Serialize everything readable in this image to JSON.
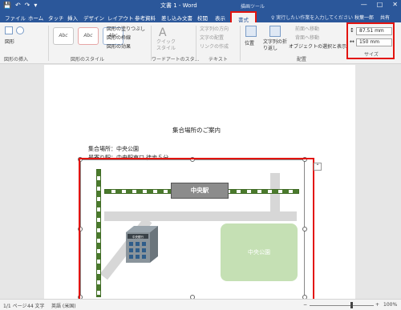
{
  "titlebar": {
    "document_title": "文書 1 - Word",
    "context_title": "描画ツール",
    "qat": [
      "save-icon",
      "undo-icon",
      "redo-icon",
      "dropdown-icon"
    ],
    "window_buttons": [
      "—",
      "□",
      "✕"
    ]
  },
  "tabs": [
    {
      "id": "file",
      "label": "ファイル"
    },
    {
      "id": "home",
      "label": "ホーム"
    },
    {
      "id": "touch",
      "label": "タッチ"
    },
    {
      "id": "insert",
      "label": "挿入"
    },
    {
      "id": "design",
      "label": "デザイン"
    },
    {
      "id": "layout",
      "label": "レイアウト"
    },
    {
      "id": "references",
      "label": "参考資料"
    },
    {
      "id": "mailings",
      "label": "差し込み文書"
    },
    {
      "id": "review",
      "label": "校閲"
    },
    {
      "id": "view",
      "label": "表示"
    },
    {
      "id": "format",
      "label": "書式",
      "active": true
    }
  ],
  "tellme": "♀ 実行したい作業を入力してください",
  "user": "秋葉一郎",
  "share": "共有",
  "ribbon": {
    "insert_shapes": {
      "label": "図形の挿入",
      "shapes_button": "図形"
    },
    "shape_styles": {
      "label": "図形のスタイル",
      "swatches": [
        "Abc",
        "Abc",
        "Abc"
      ],
      "fill": "図形の塗りつぶし",
      "outline": "図形の枠線",
      "effects": "図形の効果"
    },
    "wordart": {
      "label": "ワードアートのスタ…",
      "quick_style": "クイック\nスタイル"
    },
    "text": {
      "label": "テキスト",
      "direction": "文字列の方向",
      "align": "文字の配置",
      "link": "リンクの作成"
    },
    "arrange": {
      "label": "配置",
      "position": "位置",
      "wrap": "文字列の折\nり返し",
      "forward": "前面へ移動",
      "backward": "背面へ移動",
      "selection_pane": "オブジェクトの選択と表示"
    },
    "size": {
      "label": "サイズ",
      "height": "87.51 mm",
      "width": "150 mm"
    }
  },
  "document": {
    "title": "集合場所のご案内",
    "line1": "集合場所：中央公園",
    "line2": "最寄り駅：中央駅東口 徒歩５分"
  },
  "map": {
    "station_label": "中央駅",
    "park_label": "中央公園",
    "bank_label": "中央銀行",
    "colors": {
      "rail": "#4a7a2c",
      "park": "#c5e0b4",
      "road": "#d7d7d7",
      "station": "#8c8c8c"
    }
  },
  "statusbar": {
    "page": "1/1 ページ",
    "words": "44 文字",
    "lang": "英語 (米国)",
    "zoom": "100%"
  },
  "highlight_color": "#e3140f",
  "accent_color": "#2b579a"
}
